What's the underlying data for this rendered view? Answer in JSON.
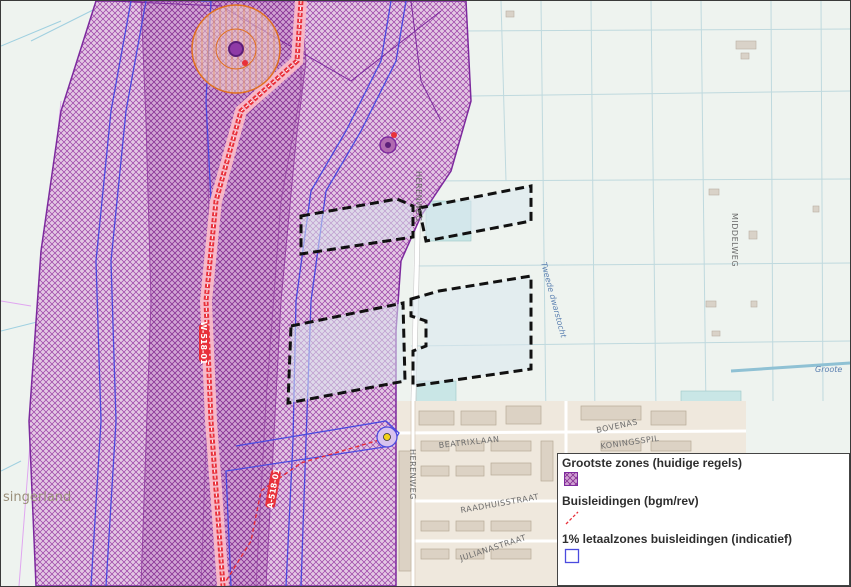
{
  "map": {
    "streets": {
      "middelweg": "MIDDELWEG",
      "tweede_dwarstocht": "Tweede dwarstocht",
      "beatrixlaan": "BEATRIXLAAN",
      "bovenas": "BOVENAS",
      "koningsspil": "KONINGSSPIL",
      "herenweg": "HERENWEG",
      "raadhuisstraat": "RAADHUISSTRAAT",
      "julianastraat": "JULIANASTRAAT",
      "groote": "Groote",
      "herenweg_top": "HERENWEG"
    },
    "place": "singerland",
    "pipelines": {
      "main": "W-518-01",
      "branch": "A-518-01"
    }
  },
  "legend": {
    "items": [
      {
        "title": "Grootste zones (huidige regels)",
        "symbol": "crosshatch-purple-icon"
      },
      {
        "title": "Buisleidingen (bgm/rev)",
        "symbol": "dashed-red-line-icon"
      },
      {
        "title": "1% letaalzones buisleidingen (indicatief)",
        "symbol": "blue-outline-square-icon"
      }
    ]
  },
  "colors": {
    "zone_fill": "#b06ab0",
    "zone_stroke": "#7d2a9e",
    "pipe": "#e8303a",
    "lethal": "#4b4bdf",
    "plan": "#111111"
  }
}
